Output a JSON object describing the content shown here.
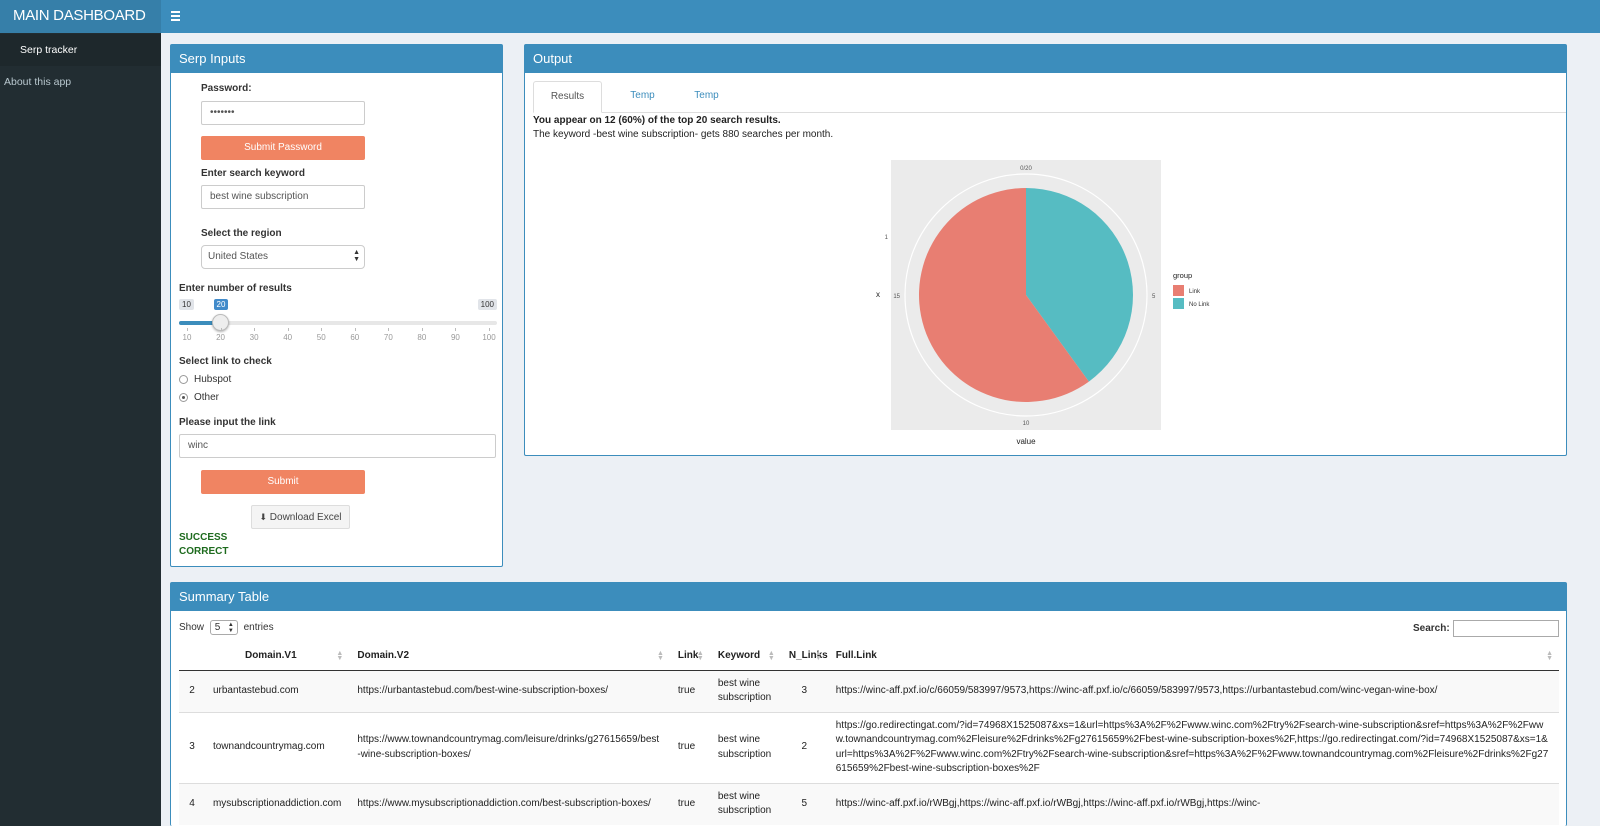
{
  "header": {
    "title": "MAIN DASHBOARD",
    "menu_icon": "hamburger-icon"
  },
  "sidebar": {
    "items": [
      {
        "label": "Serp tracker",
        "active": true
      },
      {
        "label": "About this app",
        "active": false
      }
    ]
  },
  "inputs": {
    "title": "Serp Inputs",
    "password_label": "Password:",
    "password_value": "•••••••",
    "submit_password_label": "Submit Password",
    "keyword_label": "Enter search keyword",
    "keyword_value": "best wine subscription",
    "region_label": "Select the region",
    "region_value": "United States",
    "results_label": "Enter number of results",
    "slider": {
      "min": 10,
      "max": 100,
      "value": 20,
      "min_label": "10",
      "max_label": "100",
      "value_label": "20",
      "ticks": [
        "10",
        "20",
        "30",
        "40",
        "50",
        "60",
        "70",
        "80",
        "90",
        "100"
      ]
    },
    "link_check_label": "Select link to check",
    "radio_options": [
      {
        "label": "Hubspot",
        "checked": false
      },
      {
        "label": "Other",
        "checked": true
      }
    ],
    "link_input_label": "Please input the link",
    "link_input_value": "winc",
    "submit_label": "Submit",
    "download_label": "Download Excel",
    "download_icon": "download-icon",
    "status_1": "SUCCESS",
    "status_2": "CORRECT"
  },
  "output": {
    "title": "Output",
    "tabs": [
      "Results",
      "Temp",
      "Temp"
    ],
    "result_line": "You appear on 12 (60%) of the top 20 search results.",
    "keyword_line": "The keyword -best wine subscription- gets 880 searches per month.",
    "colors": {
      "link": "#e87e72",
      "no_link": "#56bcc2"
    }
  },
  "chart_data": {
    "type": "pie",
    "title": "",
    "xlabel": "value",
    "ylabel": "x",
    "y_tick": "1",
    "angle_ticks": [
      "0/20",
      "5",
      "10",
      "15"
    ],
    "legend_title": "group",
    "legend_position": "right",
    "categories": [
      "Link",
      "No Link"
    ],
    "values": [
      12,
      8
    ],
    "total": 20
  },
  "summary": {
    "title": "Summary Table",
    "show_label": "Show",
    "entries_value": "5",
    "entries_label": "entries",
    "search_label": "Search:",
    "columns": [
      "",
      "Domain.V1",
      "Domain.V2",
      "Link",
      "Keyword",
      "N_Links",
      "Full.Link"
    ],
    "rows": [
      [
        "2",
        "urbantastebud.com",
        "https://urbantastebud.com/best-wine-subscription-boxes/",
        "true",
        "best wine subscription",
        "3",
        "https://winc-aff.pxf.io/c/66059/583997/9573,https://winc-aff.pxf.io/c/66059/583997/9573,https://urbantastebud.com/winc-vegan-wine-box/"
      ],
      [
        "3",
        "townandcountrymag.com",
        "https://www.townandcountrymag.com/leisure/drinks/g27615659/best-wine-subscription-boxes/",
        "true",
        "best wine subscription",
        "2",
        "https://go.redirectingat.com/?id=74968X1525087&xs=1&url=https%3A%2F%2Fwww.winc.com%2Ftry%2Fsearch-wine-subscription&sref=https%3A%2F%2Fwww.townandcountrymag.com%2Fleisure%2Fdrinks%2Fg27615659%2Fbest-wine-subscription-boxes%2F,https://go.redirectingat.com/?id=74968X1525087&xs=1&url=https%3A%2F%2Fwww.winc.com%2Ftry%2Fsearch-wine-subscription&sref=https%3A%2F%2Fwww.townandcountrymag.com%2Fleisure%2Fdrinks%2Fg27615659%2Fbest-wine-subscription-boxes%2F"
      ],
      [
        "4",
        "mysubscriptionaddiction.com",
        "https://www.mysubscriptionaddiction.com/best-subscription-boxes/",
        "true",
        "best wine subscription",
        "5",
        "https://winc-aff.pxf.io/rWBgj,https://winc-aff.pxf.io/rWBgj,https://winc-aff.pxf.io/rWBgj,https://winc-"
      ]
    ]
  }
}
